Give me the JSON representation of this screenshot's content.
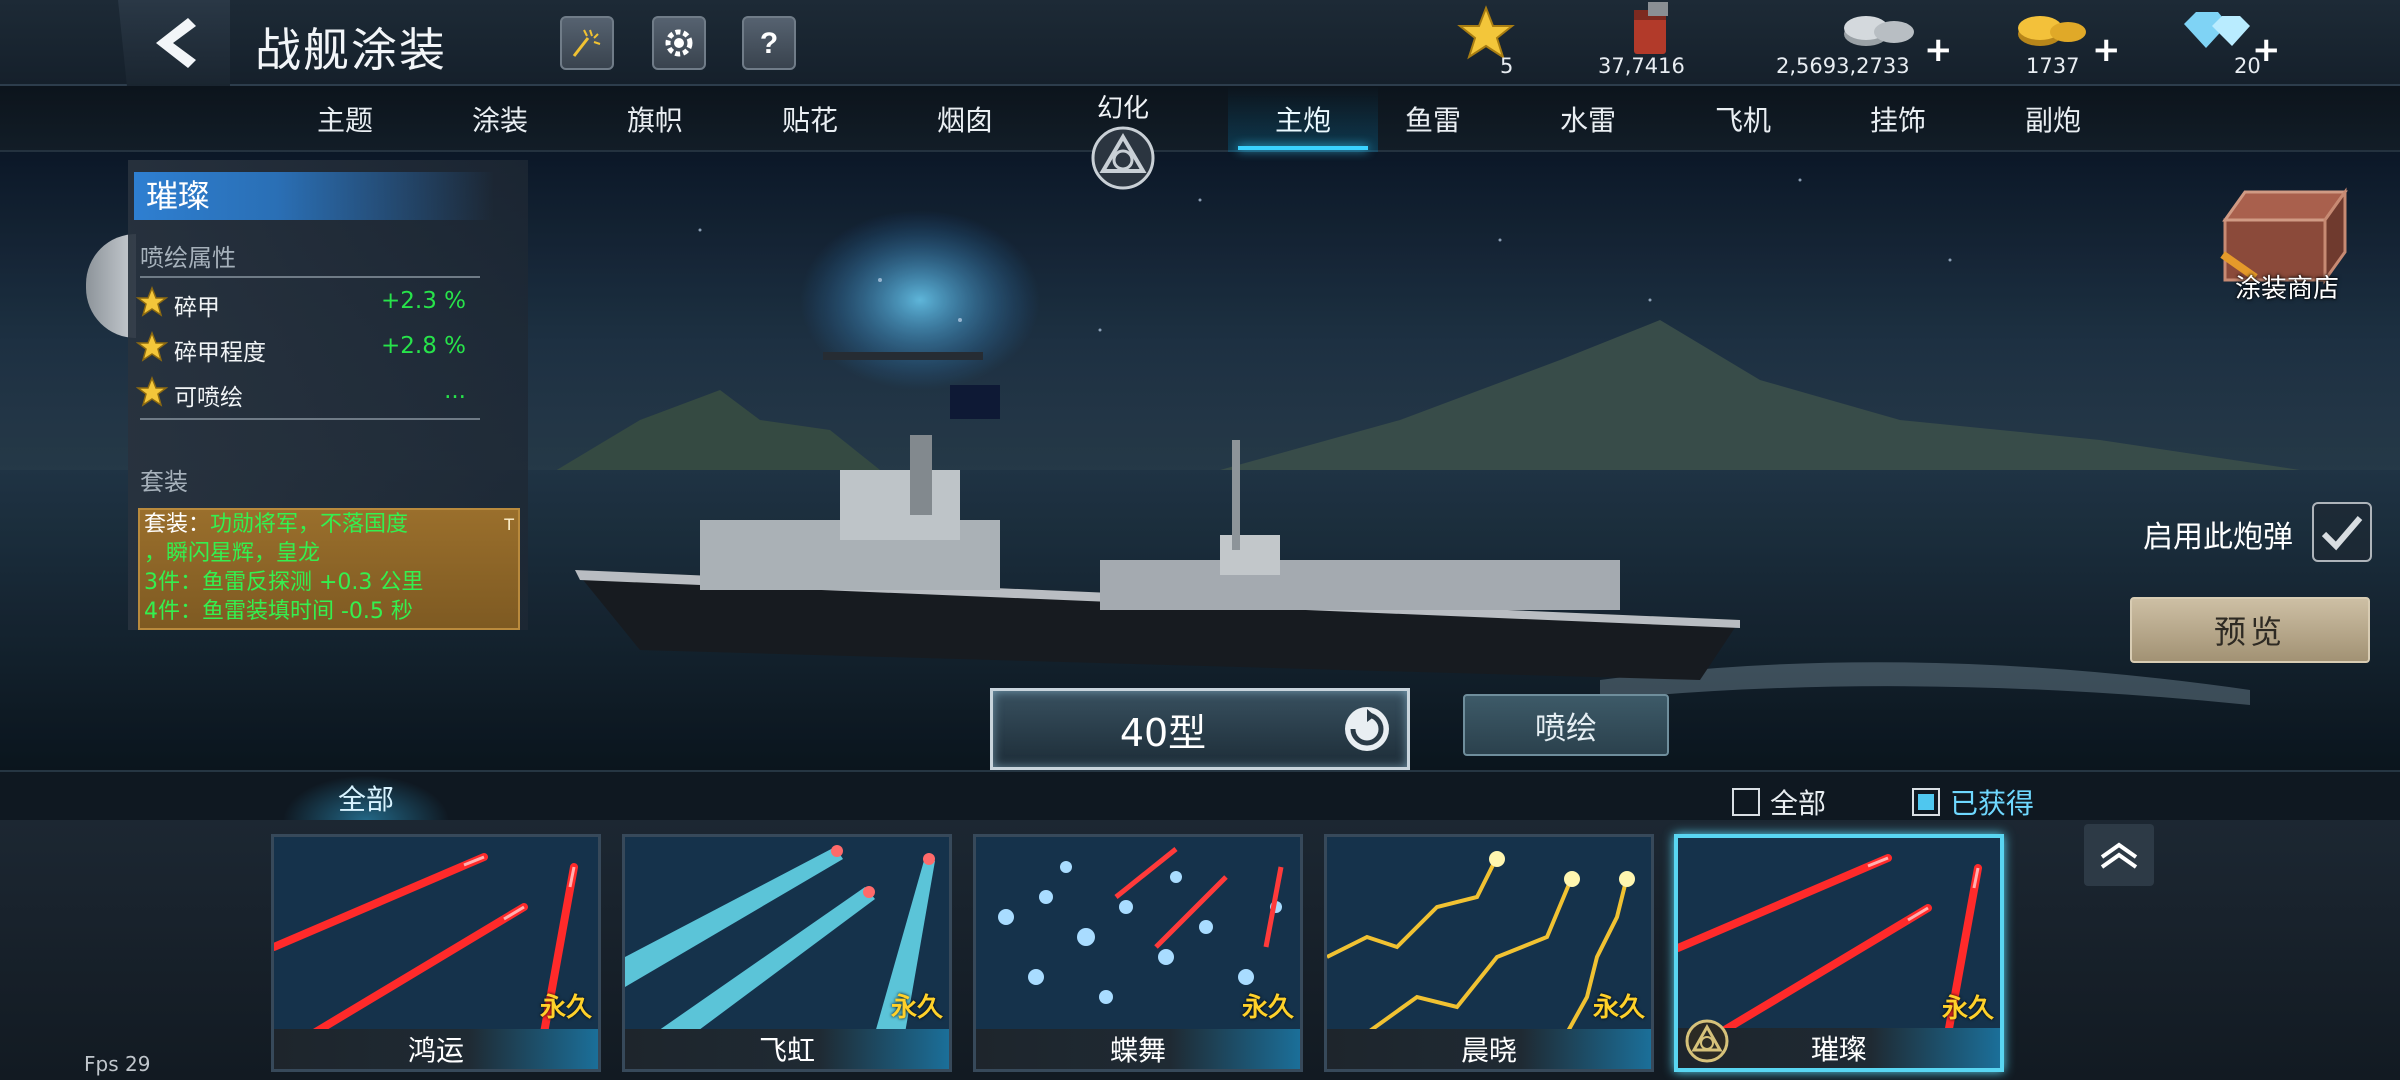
{
  "header": {
    "title": "战舰涂装",
    "resources": {
      "star": "5",
      "paint": "37,7416",
      "silver": "2,5693,2733",
      "gold": "1737",
      "diamond": "20"
    },
    "plus": "+"
  },
  "tabs": [
    {
      "label": "主题"
    },
    {
      "label": "涂装"
    },
    {
      "label": "旗帜"
    },
    {
      "label": "贴花"
    },
    {
      "label": "烟囱"
    },
    {
      "label": "主炮"
    },
    {
      "label": "鱼雷"
    },
    {
      "label": "水雷"
    },
    {
      "label": "飞机"
    },
    {
      "label": "挂饰"
    },
    {
      "label": "副炮"
    }
  ],
  "active_tab": "主炮",
  "huanhua_label": "幻化",
  "left_panel": {
    "skin_name": "璀璨",
    "spray_section": "喷绘属性",
    "attributes": [
      {
        "name": "碎甲",
        "value": "+2.3 %"
      },
      {
        "name": "碎甲程度",
        "value": "+2.8 %"
      },
      {
        "name": "可喷绘",
        "value": "..."
      }
    ],
    "set_section": "套装",
    "set_box": {
      "l1_prefix": "套装：",
      "l1_green": "功勋将军，不落国度",
      "l2_green": "，瞬闪星辉，皇龙",
      "l3": "3件：鱼雷反探测 +0.3 公里",
      "l4": "4件：鱼雷装填时间 -0.5 秒",
      "tag": "T"
    }
  },
  "shop_label": "涂装商店",
  "enable_label": "启用此炮弹",
  "preview_label": "预览",
  "ammo": {
    "current": "40型"
  },
  "paint_button": "喷绘",
  "bottom": {
    "tab_all": "全部",
    "filter_all": "全部",
    "filter_owned": "已获得"
  },
  "cards": [
    {
      "name": "鸿运",
      "perm": "永久",
      "style": "red"
    },
    {
      "name": "飞虹",
      "perm": "永久",
      "style": "cyan"
    },
    {
      "name": "蝶舞",
      "perm": "永久",
      "style": "butterfly"
    },
    {
      "name": "晨晓",
      "perm": "永久",
      "style": "gold"
    },
    {
      "name": "璀璨",
      "perm": "永久",
      "style": "red",
      "selected": true
    }
  ],
  "fps": "Fps 29",
  "colors": {
    "accent": "#3ad2ff",
    "stat_green": "#27e34a",
    "perm_yellow": "#ffd12a"
  }
}
